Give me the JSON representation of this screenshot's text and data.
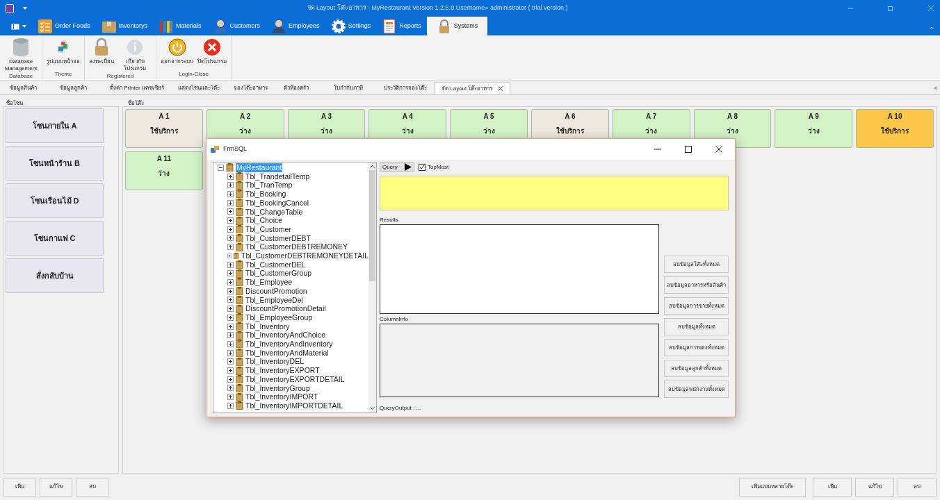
{
  "window": {
    "title": "จัด Layout โต๊ะอาหาร - MyRestaurant Version 1.2.5.0 Username= administrator ( trial version )"
  },
  "ribbon_tabs": [
    {
      "label": "Order Foods",
      "selected": false
    },
    {
      "label": "Inventorys",
      "selected": false
    },
    {
      "label": "Materials",
      "selected": false
    },
    {
      "label": "Customers",
      "selected": false
    },
    {
      "label": "Employees",
      "selected": false
    },
    {
      "label": "Settings",
      "selected": false
    },
    {
      "label": "Reports",
      "selected": false
    },
    {
      "label": "Systems",
      "selected": true
    }
  ],
  "ribbon_groups": [
    {
      "label": "Database",
      "buttons": [
        "Database Management"
      ]
    },
    {
      "label": "Theme",
      "buttons": [
        "รูปแบบหน้าจอ"
      ]
    },
    {
      "label": "Registered",
      "buttons": [
        "ลงทะเบียน",
        "เกี่ยวกับโปรแกรม"
      ]
    },
    {
      "label": "Login-Close",
      "buttons": [
        "ออกจากระบบ",
        "ปิดโปรแกรม"
      ]
    }
  ],
  "document_tabs": [
    {
      "label": "ข้อมูลสินค้า",
      "selected": false
    },
    {
      "label": "ข้อมูลลูกค้า",
      "selected": false
    },
    {
      "label": "ตั้งค่า Printer แคชเชียร์",
      "selected": false
    },
    {
      "label": "แสดงโซนและโต๊ะ",
      "selected": false
    },
    {
      "label": "จองโต๊ะอาหาร",
      "selected": false
    },
    {
      "label": "ตัวห้องครัว",
      "selected": false
    },
    {
      "label": "ใบกำกับภาษี",
      "selected": false
    },
    {
      "label": "ประวัติการจองโต๊ะ",
      "selected": false
    },
    {
      "label": "จัด Layout โต๊ะอาหาร",
      "selected": true
    }
  ],
  "zones": {
    "title": "ชื่อโซน",
    "items": [
      "โซนภายใน A",
      "โซนหน้าร้าน B",
      "โซนเรือนไม้ D",
      "โซนกาแฟ C",
      "สั่งกลับบ้าน"
    ]
  },
  "tables": {
    "title": "ชื่อโต๊ะ",
    "items": [
      {
        "name": "A 1",
        "status": "ใช้บริการ",
        "color": "#eee8df"
      },
      {
        "name": "A 2",
        "status": "ว่าง",
        "color": "#d3f2c6"
      },
      {
        "name": "A 3",
        "status": "ว่าง",
        "color": "#d3f2c6"
      },
      {
        "name": "A 4",
        "status": "ว่าง",
        "color": "#d3f2c6"
      },
      {
        "name": "A 5",
        "status": "ว่าง",
        "color": "#d3f2c6"
      },
      {
        "name": "A 6",
        "status": "ใช้บริการ",
        "color": "#eee8df"
      },
      {
        "name": "A 7",
        "status": "ว่าง",
        "color": "#d3f2c6"
      },
      {
        "name": "A 8",
        "status": "ว่าง",
        "color": "#d3f2c6"
      },
      {
        "name": "A 9",
        "status": "ว่าง",
        "color": "#d3f2c6"
      },
      {
        "name": "A 10",
        "status": "ใช้บริการ",
        "color": "#fcc748"
      },
      {
        "name": "A 11",
        "status": "ว่าง",
        "color": "#d3f2c6"
      }
    ]
  },
  "dialog": {
    "title": "FrmSQL",
    "tree": {
      "label": "MyRestaurant",
      "selected": true,
      "expanded": true,
      "children": [
        {
          "label": "Tbl_TrandetailTemp",
          "expanded": false
        },
        {
          "label": "Tbl_TranTemp",
          "expanded": false
        },
        {
          "label": "Tbl_Booking",
          "expanded": false
        },
        {
          "label": "Tbl_BookingCancel",
          "expanded": false
        },
        {
          "label": "Tbl_ChangeTable",
          "expanded": false
        },
        {
          "label": "Tbl_Choice",
          "expanded": false
        },
        {
          "label": "Tbl_Customer",
          "expanded": false
        },
        {
          "label": "Tbl_CustomerDEBT",
          "expanded": false
        },
        {
          "label": "Tbl_CustomerDEBTREMONEY",
          "expanded": false
        },
        {
          "label": "Tbl_CustomerDEBTREMONEYDETAIL",
          "expanded": false
        },
        {
          "label": "Tbl_CustomerDEL",
          "expanded": false
        },
        {
          "label": "Tbl_CustomerGroup",
          "expanded": false
        },
        {
          "label": "Tbl_Employee",
          "expanded": false
        },
        {
          "label": "DiscountPromotion",
          "expanded": false
        },
        {
          "label": "Tbl_EmployeeDel",
          "expanded": false
        },
        {
          "label": "DiscountPromotionDetail",
          "expanded": false
        },
        {
          "label": "Tbl_EmployeeGroup",
          "expanded": false
        },
        {
          "label": "Tbl_Inventory",
          "expanded": false
        },
        {
          "label": "Tbl_InventoryAndChoice",
          "expanded": false
        },
        {
          "label": "Tbl_InventoryAndInventory",
          "expanded": false
        },
        {
          "label": "Tbl_InventoryAndMaterial",
          "expanded": false
        },
        {
          "label": "Tbl_InventoryDEL",
          "expanded": false
        },
        {
          "label": "Tbl_InventoryEXPORT",
          "expanded": false
        },
        {
          "label": "Tbl_InventoryEXPORTDETAIL",
          "expanded": false
        },
        {
          "label": "Tbl_InventoryGroup",
          "expanded": false
        },
        {
          "label": "Tbl_InventoryIMPORT",
          "expanded": false
        },
        {
          "label": "Tbl_InventoryIMPORTDETAIL",
          "expanded": false
        }
      ]
    },
    "query_button": "Query",
    "topmost": {
      "label": "TopMost",
      "checked": true
    },
    "results_label": "Results",
    "columninfo_label": "ColumnInfo",
    "query_output": "QueryOutput : ...",
    "actions": [
      "ลบข้อมูลโต๊ะทั้งหมด",
      "ลบข้อมูลอาหารหรือสินค้า",
      "ลบข้อมูลการขายทั้งหมด",
      "ลบข้อมูลทั้งหมด",
      "ลบข้อมูลการจองทั้งหมด",
      "ลบข้อมูลลูกค้าทั้งหมด",
      "ลบข้อมูลพนักงานทั้งหมด"
    ]
  },
  "bottom_left": [
    "เพิ่ม",
    "แก้ไข",
    "ลบ"
  ],
  "bottom_right": [
    "เพิ่มแบบหลายโต๊ะ",
    "เพิ่ม",
    "แก้ไข",
    "ลบ"
  ]
}
